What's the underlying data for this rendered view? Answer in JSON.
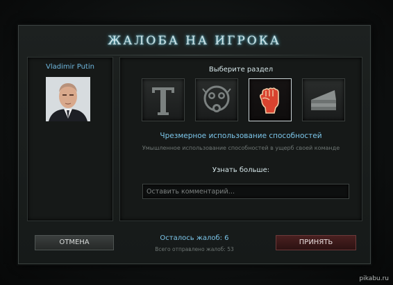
{
  "dialog": {
    "title": "ЖАЛОБА НА ИГРОКА"
  },
  "player": {
    "name": "Vladimir Putin",
    "avatar_icon": "player-portrait"
  },
  "report": {
    "section_heading": "Выберите раздел",
    "categories": [
      {
        "icon": "letter-t-icon",
        "selected": false
      },
      {
        "icon": "gas-mask-icon",
        "selected": false
      },
      {
        "icon": "raised-fist-icon",
        "selected": true
      },
      {
        "icon": "cake-slice-icon",
        "selected": false
      }
    ],
    "selected_title": "Чрезмерное использование способностей",
    "selected_description": "Умышленное использование способностей в ущерб своей команде",
    "learn_more": "Узнать больше:",
    "comment_placeholder": "Оставить комментарий…",
    "comment_value": ""
  },
  "footer": {
    "cancel_label": "ОТМЕНА",
    "accept_label": "ПРИНЯТЬ",
    "remaining_reports": "Осталось жалоб: 6",
    "total_sent": "Всего отправлено жалоб: 53"
  },
  "watermark": "pikabu.ru",
  "colors": {
    "accent_blue": "#7cc6ea",
    "title_glow": "#4fb7d0",
    "accept_red": "#4a2020",
    "fist_red": "#d9432f"
  }
}
